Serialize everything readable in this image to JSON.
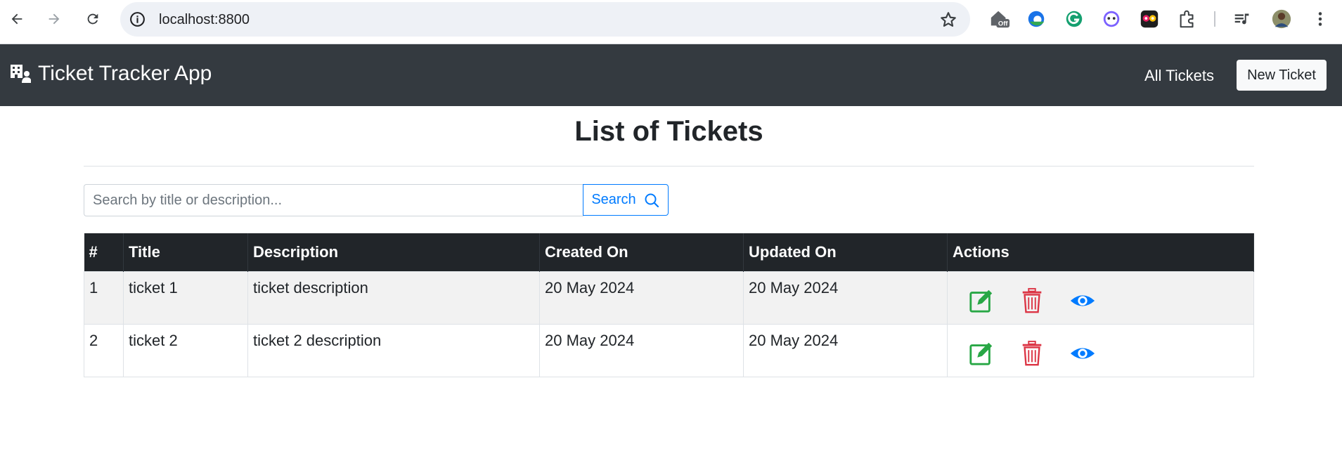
{
  "browser": {
    "url": "localhost:8800",
    "extensions": [
      "off-badge-icon",
      "edge-icon",
      "grammarly-icon",
      "ghost-icon",
      "owl-icon",
      "puzzle-icon",
      "media-icon",
      "profile-avatar"
    ],
    "off_badge": "Off"
  },
  "navbar": {
    "brand": "Ticket Tracker App",
    "links": [
      "All Tickets"
    ],
    "new_ticket": "New Ticket"
  },
  "main": {
    "title": "List of Tickets",
    "search": {
      "placeholder": "Search by title or description...",
      "button": "Search"
    }
  },
  "table": {
    "columns": [
      "#",
      "Title",
      "Description",
      "Created On",
      "Updated On",
      "Actions"
    ],
    "rows": [
      {
        "id": "1",
        "title": "ticket 1",
        "description": "ticket description",
        "created": "20 May 2024",
        "updated": "20 May 2024"
      },
      {
        "id": "2",
        "title": "ticket 2",
        "description": "ticket 2 description",
        "created": "20 May 2024",
        "updated": "20 May 2024"
      }
    ]
  },
  "colors": {
    "navbar": "#343a40",
    "edit": "#28a745",
    "delete": "#dc3545",
    "view": "#007bff"
  }
}
